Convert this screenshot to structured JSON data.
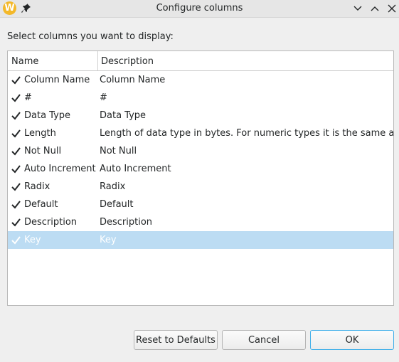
{
  "window": {
    "title": "Configure columns",
    "app_icon_letter": "W",
    "icons": {
      "pin": "pin-icon",
      "minimize": "chevron-down-icon",
      "maximize": "chevron-up-icon",
      "close": "close-icon"
    }
  },
  "prompt": "Select columns you want to display:",
  "table": {
    "headers": {
      "name": "Name",
      "description": "Description"
    },
    "rows": [
      {
        "name": "Column Name",
        "description": "Column Name",
        "checked": true,
        "selected": false
      },
      {
        "name": "#",
        "description": "#",
        "checked": true,
        "selected": false
      },
      {
        "name": "Data Type",
        "description": "Data Type",
        "checked": true,
        "selected": false
      },
      {
        "name": "Length",
        "description": "Length of data type in bytes. For numeric types it is the same as nur",
        "checked": true,
        "selected": false
      },
      {
        "name": "Not Null",
        "description": "Not Null",
        "checked": true,
        "selected": false
      },
      {
        "name": "Auto Increment",
        "description": "Auto Increment",
        "checked": true,
        "selected": false
      },
      {
        "name": "Radix",
        "description": "Radix",
        "checked": true,
        "selected": false
      },
      {
        "name": "Default",
        "description": "Default",
        "checked": true,
        "selected": false
      },
      {
        "name": "Description",
        "description": "Description",
        "checked": true,
        "selected": false
      },
      {
        "name": "Key",
        "description": "Key",
        "checked": true,
        "selected": true
      }
    ]
  },
  "buttons": {
    "reset": "Reset to Defaults",
    "cancel": "Cancel",
    "ok": "OK"
  },
  "colors": {
    "selection": "#bcdcf3",
    "focus": "#3daee9",
    "check": "#232627"
  }
}
